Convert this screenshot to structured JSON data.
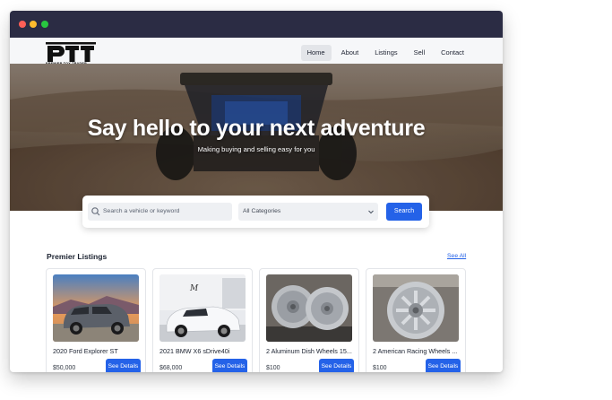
{
  "brand": {
    "logo_text": "PTT",
    "logo_subtitle": "PREMIER TOY TRADER"
  },
  "nav": {
    "items": [
      {
        "label": "Home",
        "active": true
      },
      {
        "label": "About",
        "active": false
      },
      {
        "label": "Listings",
        "active": false
      },
      {
        "label": "Sell",
        "active": false
      },
      {
        "label": "Contact",
        "active": false
      }
    ]
  },
  "hero": {
    "title": "Say hello to your next adventure",
    "subtitle": "Making buying and selling easy for you"
  },
  "search": {
    "placeholder": "Search a vehicle or keyword",
    "category_value": "All Categories",
    "button_label": "Search"
  },
  "listings": {
    "title": "Premier Listings",
    "see_all": "See All",
    "button_label": "See Details",
    "items": [
      {
        "title": "2020 Ford Explorer ST",
        "price": "$50,000",
        "image": "gray-suv"
      },
      {
        "title": "2021 BMW X6 sDrive40i",
        "price": "$68,000",
        "image": "white-suv-showroom"
      },
      {
        "title": "2 Aluminum Dish Wheels 15...",
        "price": "$100",
        "image": "chrome-wheels"
      },
      {
        "title": "2 American Racing Wheels ...",
        "price": "$100",
        "image": "racing-wheel"
      }
    ]
  },
  "colors": {
    "titlebar": "#2b2c44",
    "accent": "#2462e8",
    "navbar": "#f6f7f9"
  }
}
